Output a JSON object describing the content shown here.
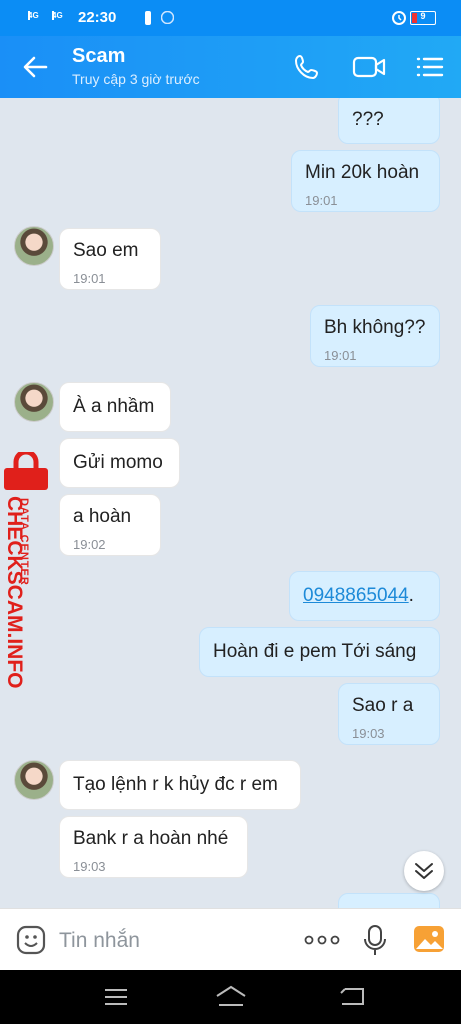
{
  "status_bar": {
    "time": "22:30",
    "net1": "4G",
    "net2": "4G",
    "battery": "9"
  },
  "header": {
    "title": "Scam",
    "subtitle": "Truy cập 3 giờ trước"
  },
  "messages": [
    {
      "dir": "out",
      "text": "???",
      "time": ""
    },
    {
      "dir": "out",
      "text": "Min 20k hoàn",
      "time": "19:01"
    },
    {
      "dir": "in",
      "text": "Sao em",
      "time": "19:01"
    },
    {
      "dir": "out",
      "text": "Bh không??",
      "time": "19:01"
    },
    {
      "dir": "in",
      "text": "À a nhầm",
      "time": ""
    },
    {
      "dir": "in",
      "text": "Gửi momo",
      "time": ""
    },
    {
      "dir": "in",
      "text": "a hoàn",
      "time": "19:02"
    },
    {
      "dir": "out",
      "text": "0948865044",
      "suffix": ".",
      "time": ""
    },
    {
      "dir": "out",
      "text": "Hoàn đi e pem Tới sáng",
      "time": ""
    },
    {
      "dir": "out",
      "text": "Sao r a",
      "time": "19:03"
    },
    {
      "dir": "in",
      "text": "Tạo lệnh r k hủy đc r em",
      "time": ""
    },
    {
      "dir": "in",
      "text": "Bank r a hoàn nhé",
      "time": "19:03"
    }
  ],
  "watermark": {
    "brand": "CHECKSCAM.INFO",
    "tag": "DATA CENTER"
  },
  "input": {
    "placeholder": "Tin nhắn"
  },
  "colors": {
    "header": "#1a8ff7",
    "bubble_out": "#d7efff",
    "bubble_in": "#ffffff",
    "background": "#dfe6ee",
    "watermark": "#e0201b"
  }
}
